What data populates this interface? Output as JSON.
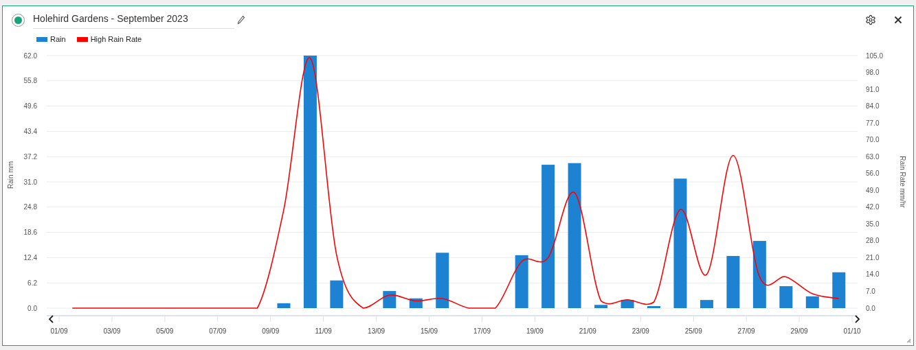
{
  "widget": {
    "title": "Holehird Gardens - September 2023"
  },
  "chart": {
    "chart_data": {
      "type": "bar",
      "ylabel": "Rain mm",
      "categories": [
        "01/09",
        null,
        "03/09",
        null,
        "05/09",
        null,
        "07/09",
        null,
        "09/09",
        null,
        "11/09",
        null,
        "13/09",
        null,
        "15/09",
        null,
        "17/09",
        null,
        "19/09",
        null,
        "21/09",
        null,
        "23/09",
        null,
        "25/09",
        null,
        "27/09",
        null,
        "29/09",
        null,
        "01/10"
      ],
      "ylim": [
        0,
        62
      ],
      "grid": true,
      "yticks": [
        {
          "value": 0,
          "label": "0.0"
        },
        {
          "value": 6.2,
          "label": "6.2"
        },
        {
          "value": 12.4,
          "label": "12.4"
        },
        {
          "value": 18.6,
          "label": "18.6"
        },
        {
          "value": 24.8,
          "label": "24.8"
        },
        {
          "value": 31,
          "label": "31.0"
        },
        {
          "value": 37.2,
          "label": "37.2"
        },
        {
          "value": 43.4,
          "label": "43.4"
        },
        {
          "value": 49.6,
          "label": "49.6"
        },
        {
          "value": 55.8,
          "label": "55.8"
        },
        {
          "value": 62,
          "label": "62.0"
        }
      ],
      "series": [
        {
          "name": "Rain",
          "color": "#1e82d2",
          "values": [
            0,
            0,
            0,
            0,
            0,
            0,
            0,
            0,
            1.2,
            62,
            6.8,
            0,
            4.2,
            2.4,
            13.6,
            0,
            0,
            13,
            35.2,
            35.6,
            0.8,
            2,
            0.5,
            31.8,
            2,
            12.8,
            16.5,
            5.4,
            2.9,
            8.8,
            null
          ]
        }
      ]
    }
  },
  "rate_chart": {
    "chart_data": {
      "type": "line",
      "ylabel": "Rain Rate mm/hr",
      "ylim": [
        0,
        105
      ],
      "yticks": [
        {
          "value": 0,
          "label": "0.0"
        },
        {
          "value": 7,
          "label": "7.0"
        },
        {
          "value": 14,
          "label": "14.0"
        },
        {
          "value": 21,
          "label": "21.0"
        },
        {
          "value": 28,
          "label": "28.0"
        },
        {
          "value": 35,
          "label": "35.0"
        },
        {
          "value": 42,
          "label": "42.0"
        },
        {
          "value": 49,
          "label": "49.0"
        },
        {
          "value": 56,
          "label": "56.0"
        },
        {
          "value": 63,
          "label": "63.0"
        },
        {
          "value": 70,
          "label": "70.0"
        },
        {
          "value": 77,
          "label": "77.0"
        },
        {
          "value": 84,
          "label": "84.0"
        },
        {
          "value": 91,
          "label": "91.0"
        },
        {
          "value": 98,
          "label": "98.0"
        },
        {
          "value": 105,
          "label": "105.0"
        }
      ],
      "series": [
        {
          "name": "High Rain Rate",
          "color": "#ff0000",
          "values": [
            0,
            0,
            0,
            0,
            0,
            0,
            0,
            0,
            41,
            104,
            22,
            0,
            5.4,
            3,
            4,
            0,
            0,
            19.4,
            21,
            48,
            3,
            3.5,
            2.5,
            41,
            14,
            63.5,
            13,
            13,
            6,
            4
          ]
        }
      ]
    }
  }
}
